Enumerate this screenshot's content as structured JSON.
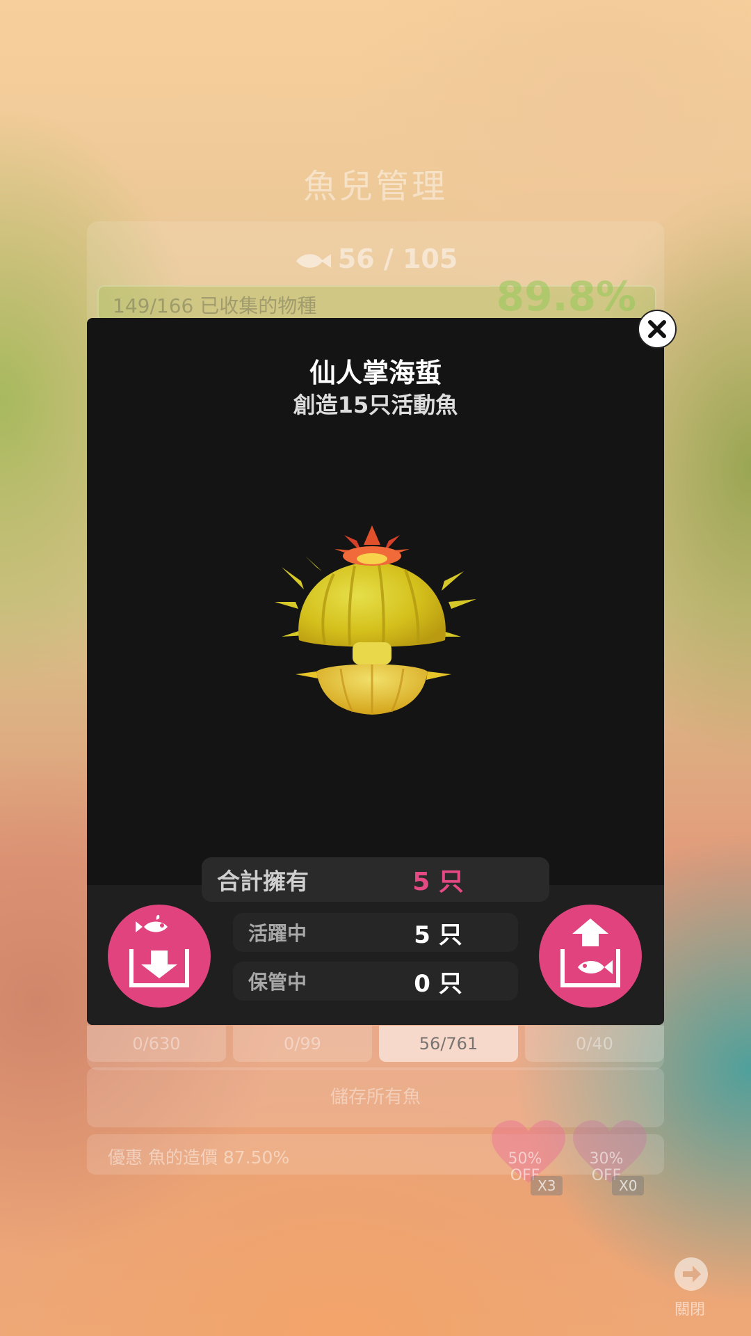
{
  "background": {
    "title": "魚兒管理",
    "fish_count": "56 / 105",
    "progress_label": "149/166 已收集的物種",
    "progress_percent": "89.8%",
    "tabs": [
      "0/630",
      "0/99",
      "56/761",
      "0/40"
    ],
    "active_tab_index": 2,
    "save_all_label": "儲存所有魚",
    "discount_label": "優惠 魚的造價 87.50%",
    "coupons": [
      {
        "percent": "50%",
        "off": "OFF",
        "multiplier": "X3"
      },
      {
        "percent": "30%",
        "off": "OFF",
        "multiplier": "X0"
      }
    ],
    "close_label": "關閉"
  },
  "modal": {
    "title": "仙人掌海蜇",
    "subtitle": "創造15只活動魚",
    "stats": {
      "total_label": "合計擁有",
      "total_value": "5 只",
      "active_label": "活躍中",
      "active_value": "5 只",
      "stored_label": "保管中",
      "stored_value": "0 只"
    }
  },
  "icons": {
    "close": "close-icon",
    "store": "fish-store-icon",
    "activate": "fish-activate-icon",
    "creature": "cactus-jellyfish-icon"
  },
  "colors": {
    "accent": "#e0437d",
    "total_value": "#e64a85",
    "modal_bg": "#141414"
  }
}
